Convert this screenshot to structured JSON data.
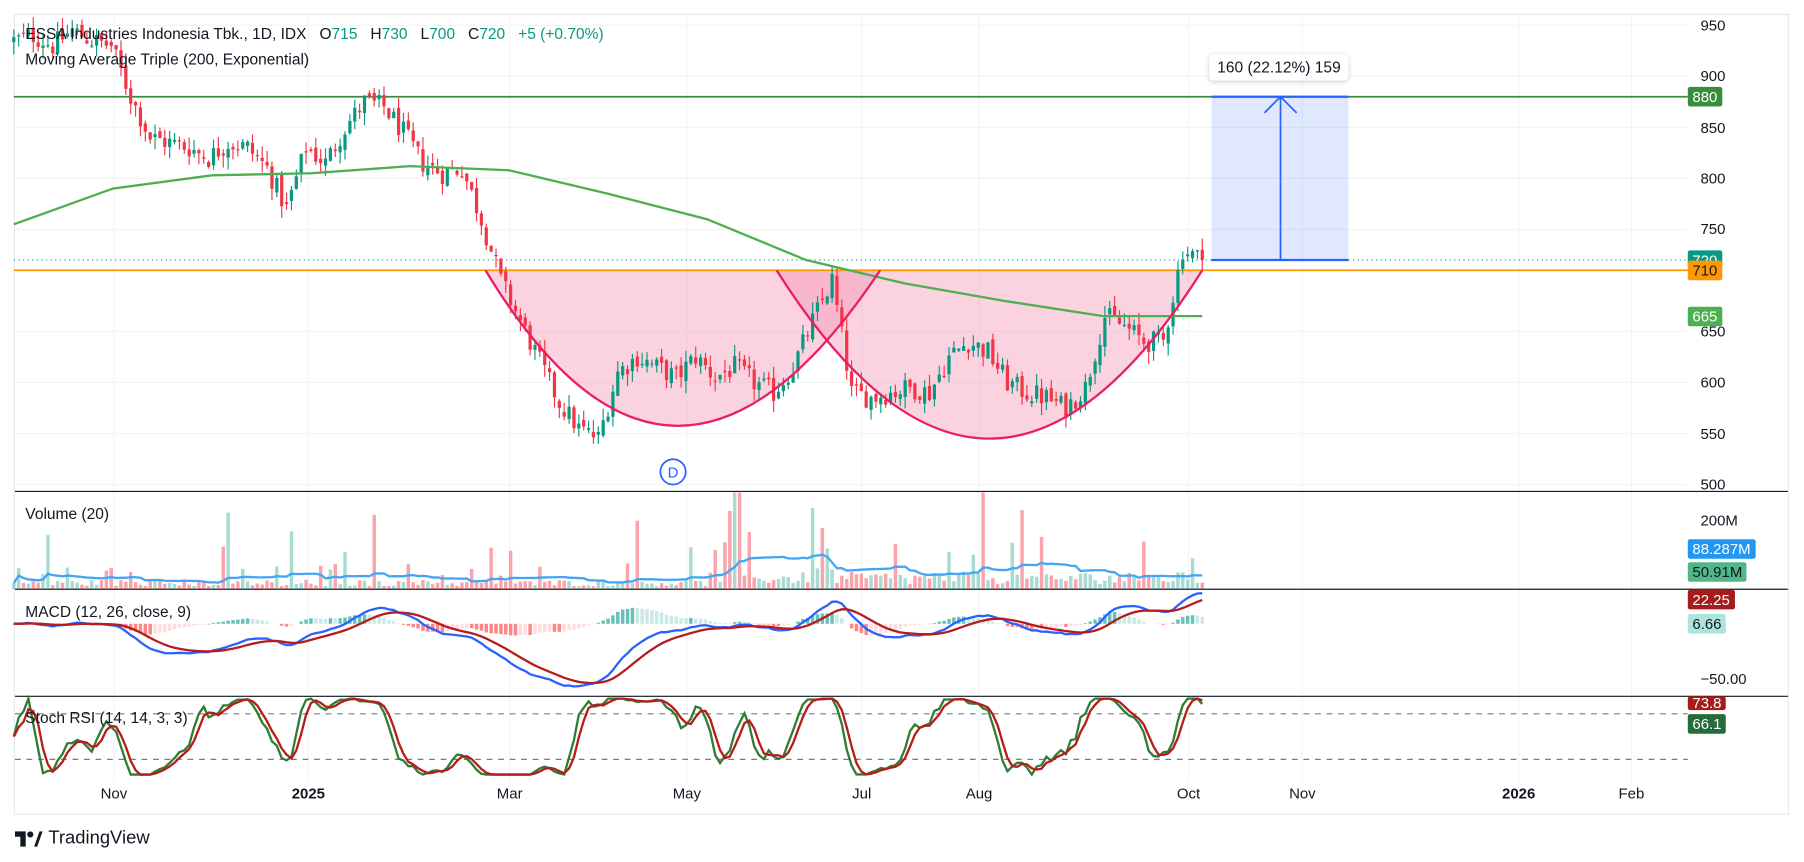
{
  "header": {
    "symbol": "ESSA Industries Indonesia Tbk., 1D, IDX",
    "o_label": "O",
    "o": "715",
    "h_label": "H",
    "h": "730",
    "l_label": "L",
    "l": "700",
    "c_label": "C",
    "c": "720",
    "change": "+5 (+0.70%)",
    "ma_label": "Moving Average Triple (200, Exponential)"
  },
  "indicators": {
    "volume": "Volume (20)",
    "macd": "MACD (12, 26, close, 9)",
    "stoch": "Stoch RSI (14, 14, 3, 3)"
  },
  "price_axis": {
    "ticks": [
      950,
      900,
      850,
      800,
      750,
      650,
      600,
      550,
      500
    ],
    "range": [
      500,
      950
    ]
  },
  "price_tags": [
    {
      "value": "880",
      "price": 880,
      "color": "#388e3c",
      "text": "#ffffff"
    },
    {
      "value": "720",
      "price": 720,
      "color": "#089981",
      "text": "#ffffff"
    },
    {
      "value": "710",
      "price": 710,
      "color": "#ff9800",
      "text": "#131722"
    },
    {
      "value": "665",
      "price": 665,
      "color": "#4caf50",
      "text": "#ffffff"
    }
  ],
  "volume_axis": {
    "tick": "200M",
    "ma_tag": "88.287M",
    "vol_tag": "50.91M",
    "ma_color": "#2196f3",
    "vol_color": "#52b788"
  },
  "macd_axis": {
    "tick": "−50.00",
    "macd_tag": "22.25",
    "hist_tag": "6.66"
  },
  "stoch_axis": {
    "k_tag": "73.8",
    "d_tag": "66.1"
  },
  "time_axis": {
    "labels": [
      "Nov",
      "2025",
      "Mar",
      "May",
      "Jul",
      "Aug",
      "Oct",
      "Nov",
      "2026",
      "Feb"
    ]
  },
  "measure": {
    "label": "160 (22.12%) 159",
    "from": 720,
    "to": 880
  },
  "levels": {
    "resistance": 880,
    "neckline": 710,
    "last": 720
  },
  "pattern_marker": "D",
  "brand": "TradingView",
  "colors": {
    "up": "#089981",
    "down": "#f23645",
    "ema": "#4caf50",
    "macd": "#2962ff",
    "signal": "#b71c1c",
    "k": "#2e7d32",
    "d": "#b71c1c",
    "cup": "#e91e63"
  },
  "series": {
    "closes": [
      935,
      940,
      930,
      945,
      935,
      930,
      880,
      840,
      835,
      830,
      820,
      835,
      830,
      810,
      770,
      830,
      815,
      850,
      875,
      870,
      845,
      815,
      805,
      810,
      760,
      700,
      660,
      620,
      580,
      555,
      545,
      610,
      625,
      615,
      605,
      625,
      605,
      615,
      600,
      590,
      615,
      660,
      700,
      590,
      585,
      590,
      595,
      590,
      625,
      640,
      630,
      600,
      590,
      585,
      575,
      595,
      665,
      655,
      640,
      640,
      730,
      720
    ],
    "ema200": [
      755,
      790,
      803,
      805,
      812,
      808,
      785,
      760,
      720,
      697,
      680,
      665,
      665
    ]
  }
}
